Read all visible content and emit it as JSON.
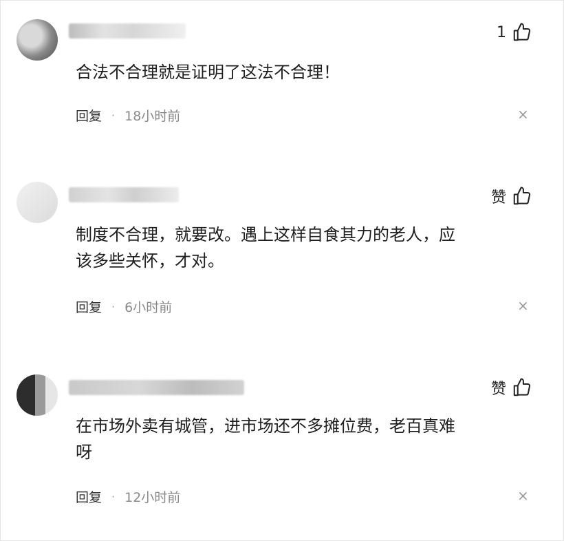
{
  "comments": [
    {
      "like_label": "1",
      "text": "合法不合理就是证明了这法不合理！",
      "reply_label": "回复",
      "separator": "·",
      "time": "18小时前"
    },
    {
      "like_label": "赞",
      "text": "制度不合理，就要改。遇上这样自食其力的老人，应\n该多些关怀，才对。",
      "reply_label": "回复",
      "separator": "·",
      "time": "6小时前"
    },
    {
      "like_label": "赞",
      "text": "在市场外卖有城管，进市场还不多摊位费，老百真难\n呀",
      "reply_label": "回复",
      "separator": "·",
      "time": "12小时前"
    }
  ],
  "icons": {
    "like": "thumbs-up-icon",
    "dismiss": "close-icon"
  },
  "colors": {
    "text": "#1f1f1f",
    "time": "#8a8a8a",
    "close": "#9a9a9a"
  }
}
